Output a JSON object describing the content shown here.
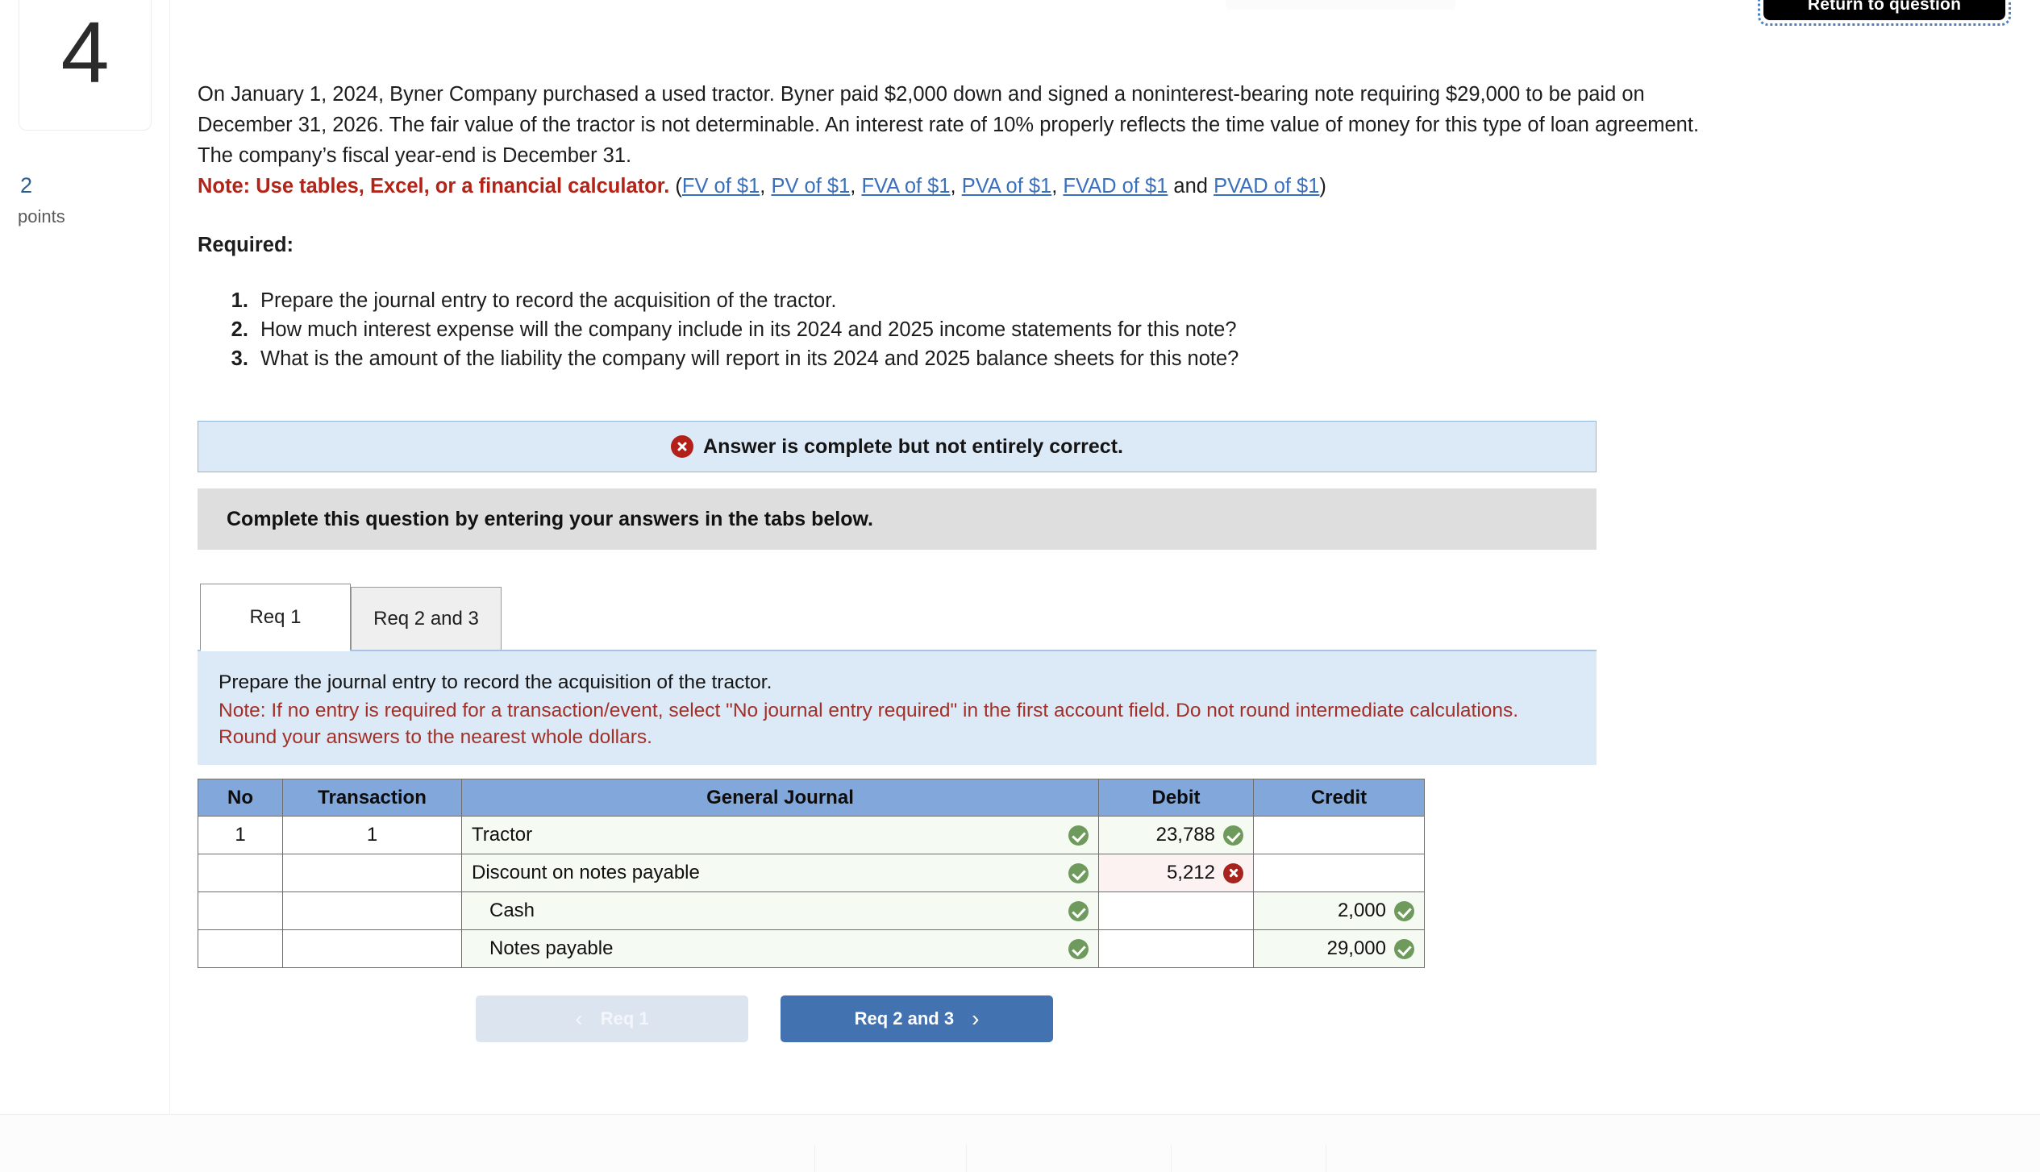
{
  "topbar": {
    "return_label": "Return to question"
  },
  "question": {
    "number": "4",
    "points_value": "2",
    "points_label": "points",
    "stem_part1": "On January 1, 2024, Byner Company purchased a used tractor. Byner paid $2,000 down and signed a noninterest-bearing note requiring $29,000 to be paid on December 31, 2026. The fair value of the tractor is not determinable. An interest rate of 10% properly reflects the time value of money for this type of loan agreement. The company’s fiscal year-end is December 31.",
    "note_label": "Note: Use tables, Excel, or a financial calculator.",
    "links_open": " (",
    "links": [
      {
        "label": "FV of $1",
        "sep": ", "
      },
      {
        "label": "PV of $1",
        "sep": ", "
      },
      {
        "label": "FVA of $1",
        "sep": ", "
      },
      {
        "label": "PVA of $1",
        "sep": ", "
      },
      {
        "label": "FVAD of $1",
        "sep": " and "
      },
      {
        "label": "PVAD of $1",
        "sep": ")"
      }
    ],
    "required_heading": "Required:",
    "required_items": [
      "Prepare the journal entry to record the acquisition of the tractor.",
      "How much interest expense will the company include in its 2024 and 2025 income statements for this note?",
      "What is the amount of the liability the company will report in its 2024 and 2025 balance sheets for this note?"
    ]
  },
  "status": {
    "icon": "x-circle-icon",
    "text": "Answer is complete but not entirely correct.",
    "banner_bg": "#dce9f7",
    "icon_color": "#b3201a"
  },
  "instruction_bar": {
    "text": "Complete this question by entering your answers in the tabs below."
  },
  "tabs": [
    {
      "label": "Req 1",
      "active": true
    },
    {
      "label": "Req 2 and 3",
      "active": false
    }
  ],
  "blue_panel": {
    "line1": "Prepare the journal entry to record the acquisition of the tractor.",
    "line2": "Note: If no entry is required for a transaction/event, select \"No journal entry required\" in the first account field. Do not round intermediate calculations. Round your answers to the nearest whole dollars.",
    "line2_color": "#a33027"
  },
  "journal": {
    "headers": [
      "No",
      "Transaction",
      "General Journal",
      "Debit",
      "Credit"
    ],
    "header_bg": "#81a7db",
    "rows": [
      {
        "no": "1",
        "transaction": "1",
        "account": "Tractor",
        "account_indent": false,
        "account_status": "correct",
        "debit": "23,788",
        "debit_status": "correct",
        "credit": "",
        "credit_status": "none"
      },
      {
        "no": "",
        "transaction": "",
        "account": "Discount on notes payable",
        "account_indent": false,
        "account_status": "correct",
        "debit": "5,212",
        "debit_status": "incorrect",
        "credit": "",
        "credit_status": "none"
      },
      {
        "no": "",
        "transaction": "",
        "account": "Cash",
        "account_indent": true,
        "account_status": "correct",
        "debit": "",
        "debit_status": "none",
        "credit": "2,000",
        "credit_status": "correct"
      },
      {
        "no": "",
        "transaction": "",
        "account": "Notes payable",
        "account_indent": true,
        "account_status": "correct",
        "debit": "",
        "debit_status": "none",
        "credit": "29,000",
        "credit_status": "correct"
      }
    ],
    "correct_color": "#6e9a5c",
    "incorrect_color": "#a8231d"
  },
  "nav": {
    "prev_label": "Req 1",
    "prev_chevron": "‹",
    "next_label": "Req 2 and 3",
    "next_chevron": "›",
    "next_bg": "#4272b0",
    "prev_bg": "#dbe4ef"
  }
}
